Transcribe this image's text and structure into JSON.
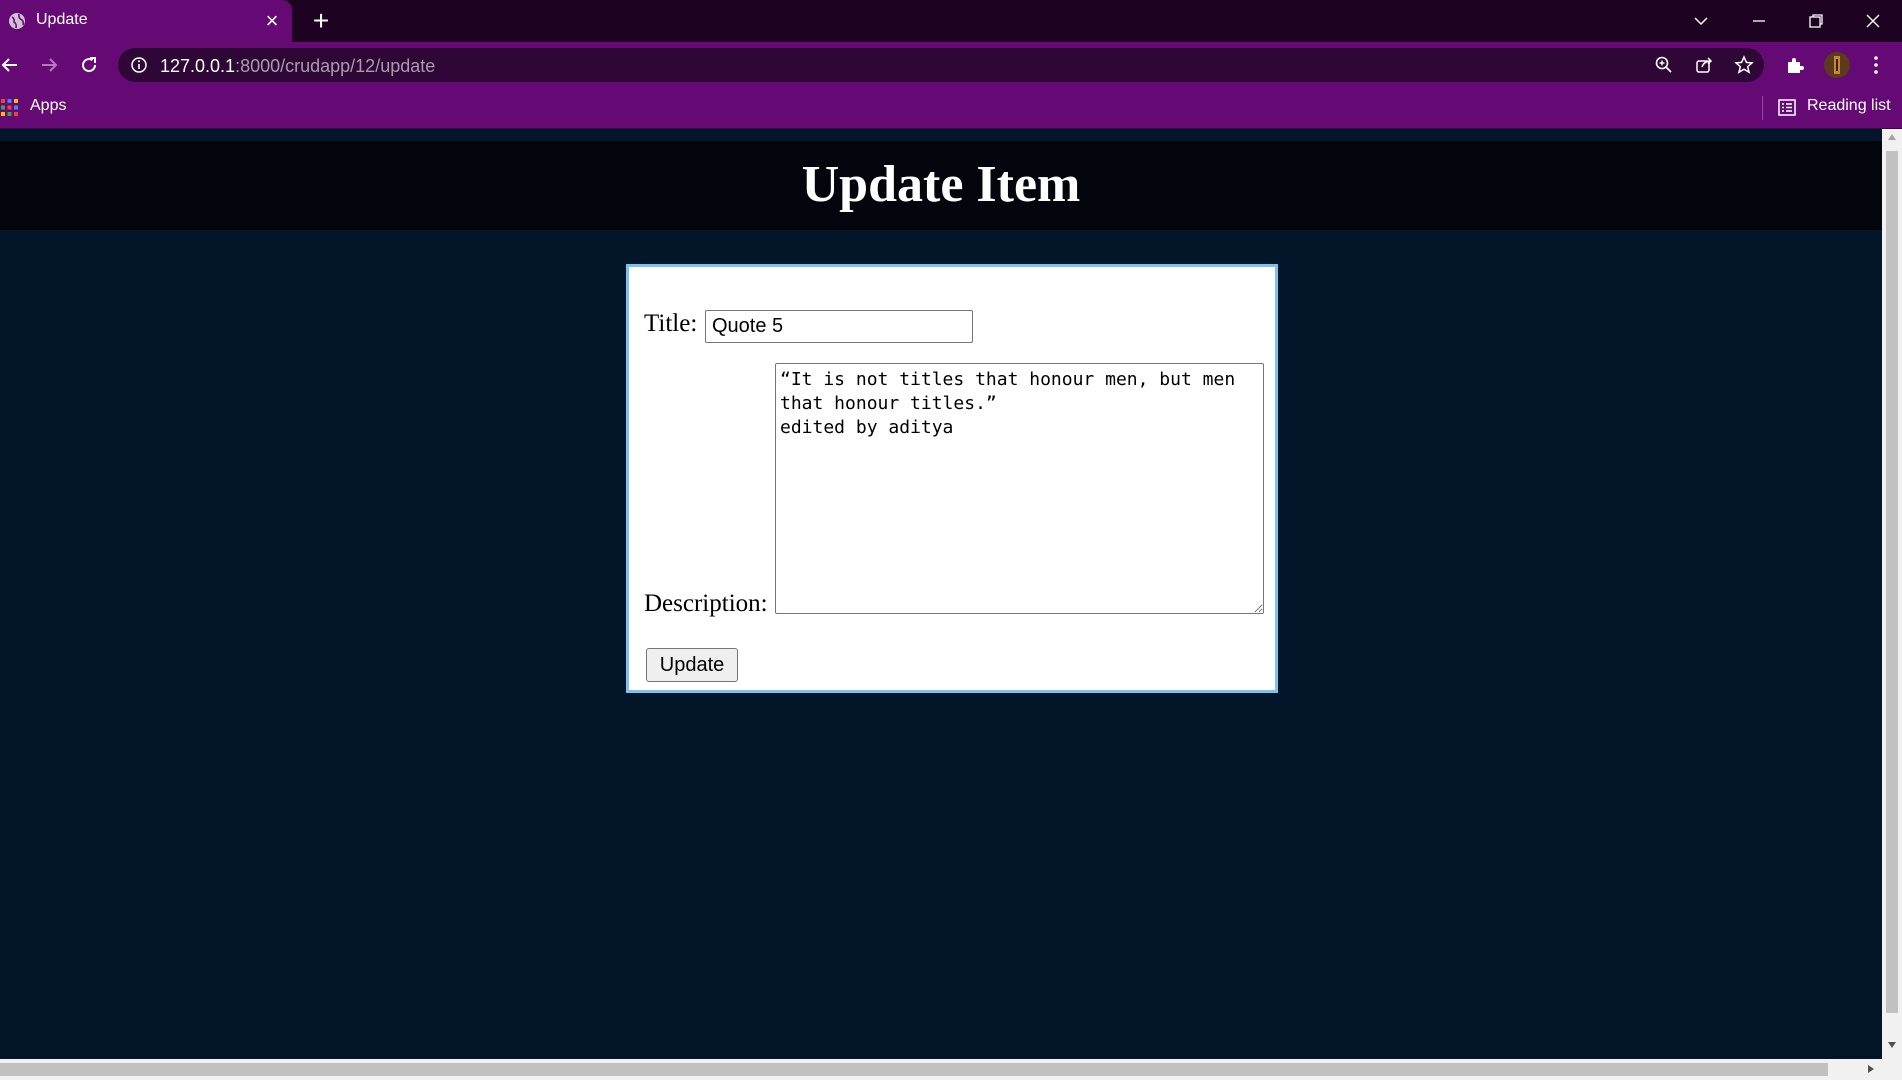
{
  "browser": {
    "tab_title": "Update",
    "url_host": "127.0.0.1",
    "url_rest": ":8000/crudapp/12/update",
    "bookmarks": {
      "apps_label": "Apps",
      "reading_list_label": "Reading list"
    },
    "icons": [
      "globe-icon",
      "close-icon",
      "plus-icon",
      "back-arrow-icon",
      "forward-arrow-icon",
      "reload-icon",
      "info-icon",
      "zoom-icon",
      "share-icon",
      "star-icon",
      "extensions-icon",
      "profile-avatar-icon",
      "menu-dots-icon",
      "apps-grid-icon",
      "reading-list-icon"
    ]
  },
  "page": {
    "heading": "Update Item",
    "form": {
      "title_label": "Title:",
      "title_value": "Quote 5",
      "description_label": "Description:",
      "description_value": "“It is not titles that honour men, but men that honour titles.”\nedited by aditya",
      "submit_label": "Update"
    }
  },
  "colors": {
    "chrome_accent": "#650a74",
    "tabstrip": "#1d0221",
    "page_background": "#021529",
    "header_background": "#02050c",
    "form_border": "#7dc3ec"
  }
}
